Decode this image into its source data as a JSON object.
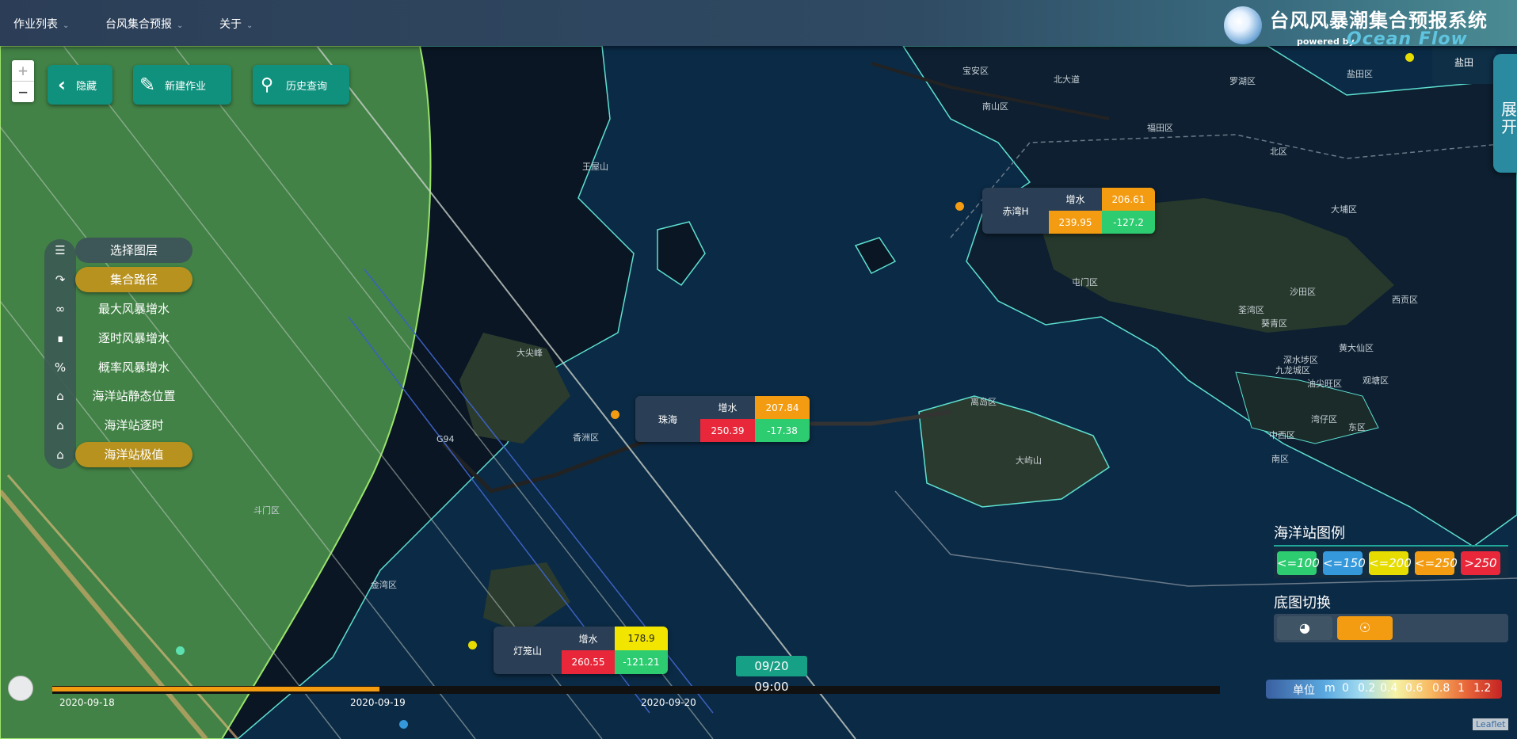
{
  "nav": {
    "menu": [
      "作业列表",
      "台风集合预报",
      "关于"
    ],
    "brand_title": "台风风暴潮集合预报系统",
    "brand_powered": "powered by",
    "brand_ocean": "Ocean Flow",
    "corner_label": "盐田"
  },
  "toolbar": {
    "zoom_in": "+",
    "zoom_out": "−",
    "hide_label": "隐藏",
    "new_job_label": "新建作业",
    "history_label": "历史查询"
  },
  "layers": [
    {
      "label": "选择图层",
      "icon": "list-icon",
      "style": "dark"
    },
    {
      "label": "集合路径",
      "icon": "route-icon",
      "style": "gold"
    },
    {
      "label": "最大风暴增水",
      "icon": "infinity-icon",
      "style": "none"
    },
    {
      "label": "逐时风暴增水",
      "icon": "step-icon",
      "style": "none"
    },
    {
      "label": "概率风暴增水",
      "icon": "percent-icon",
      "style": "none"
    },
    {
      "label": "海洋站静态位置",
      "icon": "building-icon",
      "style": "none"
    },
    {
      "label": "海洋站逐时",
      "icon": "home-icon",
      "style": "none"
    },
    {
      "label": "海洋站极值",
      "icon": "home-icon",
      "style": "gold"
    }
  ],
  "stations": [
    {
      "name": "赤湾H",
      "label": "增水",
      "v1": "206.61",
      "v2": "239.95",
      "v3": "-127.2"
    },
    {
      "name": "珠海",
      "label": "增水",
      "v1": "207.84",
      "v2": "250.39",
      "v3": "-17.38"
    },
    {
      "name": "灯笼山",
      "label": "增水",
      "v1": "178.9",
      "v2": "260.55",
      "v3": "-121.21"
    }
  ],
  "map_labels": [
    "宝安区",
    "南山区",
    "福田区",
    "罗湖区",
    "盐田区",
    "北区",
    "大埔区",
    "屯门区",
    "荃湾区",
    "沙田区",
    "西贡区",
    "葵青区",
    "黄大仙区",
    "深水埗区",
    "九龙城区",
    "油尖旺区",
    "观塘区",
    "离岛区",
    "中西区",
    "湾仔区",
    "东区",
    "南区",
    "大屿山",
    "香洲区",
    "金湾区",
    "斗门区",
    "王屋山",
    "大尖峰",
    "北大道",
    "G94"
  ],
  "expand_label": [
    "展",
    "开"
  ],
  "legend": {
    "title": "海洋站图例",
    "chips": [
      {
        "label": "<=100",
        "color": "#2ecc71"
      },
      {
        "label": "<=150",
        "color": "#3498db"
      },
      {
        "label": "<=200",
        "color": "#e6dc00"
      },
      {
        "label": "<=250",
        "color": "#f39c12"
      },
      {
        "label": ">250",
        "color": "#e8283a"
      }
    ]
  },
  "basemap": {
    "title": "底图切换"
  },
  "unit_scale": {
    "label": "单位",
    "unit": "m",
    "ticks": [
      "0",
      "0.2",
      "0.4",
      "0.6",
      "0.8",
      "1",
      "1.2"
    ]
  },
  "timeline": {
    "dates": [
      "2020-09-18",
      "2020-09-19",
      "2020-09-20"
    ],
    "current": "09/20 09:00",
    "progress": 0.28
  },
  "attribution": "Leaflet"
}
